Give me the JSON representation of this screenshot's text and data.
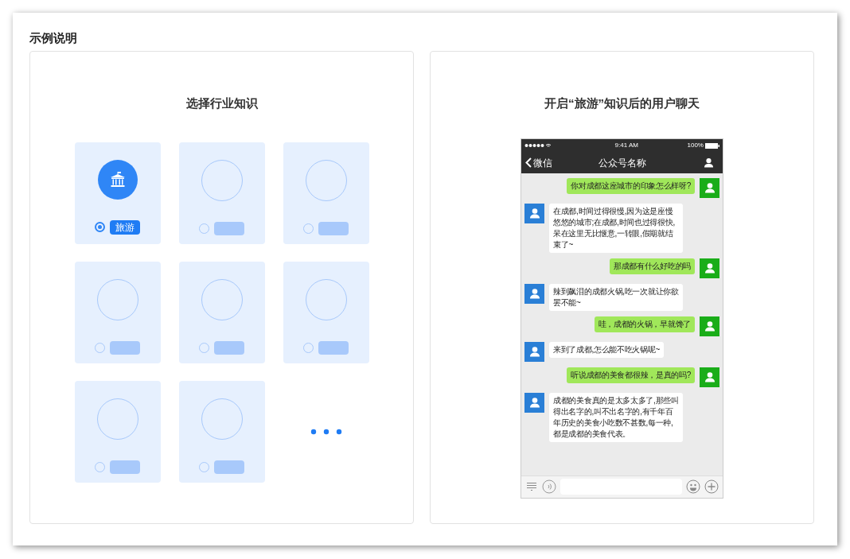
{
  "heading": "示例说明",
  "left_panel": {
    "title": "选择行业知识",
    "options": [
      {
        "label": "旅游",
        "selected": true
      },
      {
        "selected": false
      },
      {
        "selected": false
      },
      {
        "selected": false
      },
      {
        "selected": false
      },
      {
        "selected": false
      },
      {
        "selected": false
      },
      {
        "selected": false
      }
    ]
  },
  "right_panel": {
    "title": "开启“旅游”知识后的用户聊天",
    "phone": {
      "status_bar": {
        "time": "9:41 AM",
        "battery": "100%"
      },
      "nav": {
        "back": "微信",
        "title": "公众号名称"
      },
      "messages": [
        {
          "kind": "sent",
          "text": "你对成都这座城市的印象怎么样呀?"
        },
        {
          "kind": "received",
          "text": "在成都,时间过得很慢,因为这是座慢悠悠的城市;在成都,时间也过得很快,呆在这里无比惬意,一转眼,假期就结束了~"
        },
        {
          "kind": "sent",
          "text": "那成都有什么好吃的吗"
        },
        {
          "kind": "received",
          "text": "辣到飙泪的成都火锅,吃一次就让你欲罢不能~"
        },
        {
          "kind": "sent",
          "text": "哇，成都的火锅，早就馋了"
        },
        {
          "kind": "received",
          "text": "来到了成都,怎么能不吃火锅呢~"
        },
        {
          "kind": "sent",
          "text": "听说成都的美食都很辣，是真的吗?"
        },
        {
          "kind": "received",
          "text": "成都的美食真的是太多太多了,那些叫得出名字的,叫不出名字的,有千年百年历史的美食小吃数不甚数,每一种,都是成都的美食代表。"
        }
      ]
    }
  }
}
